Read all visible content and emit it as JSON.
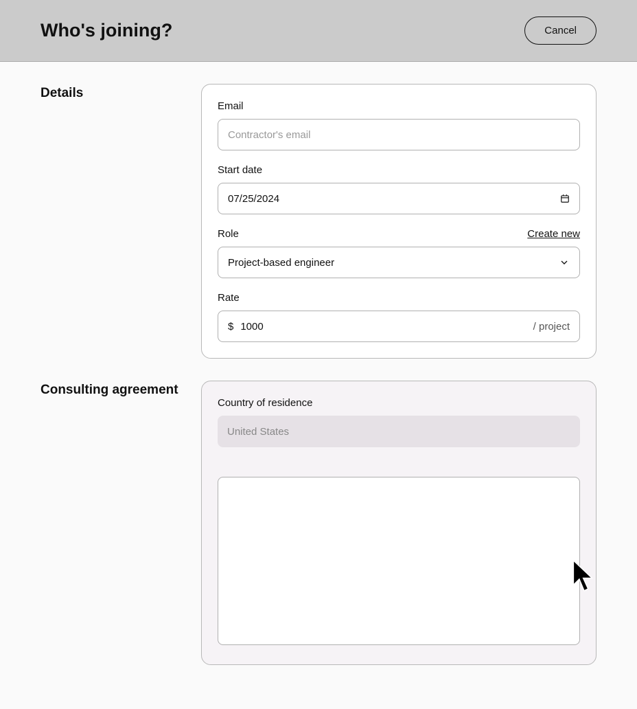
{
  "header": {
    "title": "Who's joining?",
    "cancel_label": "Cancel"
  },
  "details": {
    "section_title": "Details",
    "email": {
      "label": "Email",
      "placeholder": "Contractor's email"
    },
    "start_date": {
      "label": "Start date",
      "value": "07/25/2024"
    },
    "role": {
      "label": "Role",
      "create_new_label": "Create new",
      "value": "Project-based engineer"
    },
    "rate": {
      "label": "Rate",
      "prefix": "$",
      "value": "1000",
      "suffix": "/ project"
    }
  },
  "consulting": {
    "section_title": "Consulting agreement",
    "country": {
      "label": "Country of residence",
      "value": "United States"
    }
  }
}
